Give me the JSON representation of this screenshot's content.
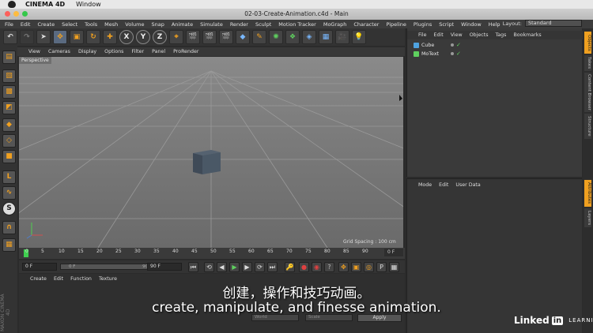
{
  "mac": {
    "app_name": "CINEMA 4D",
    "menu_window": "Window"
  },
  "window": {
    "title": "02-03-Create-Animation.c4d - Main"
  },
  "menu": [
    "File",
    "Edit",
    "Create",
    "Select",
    "Tools",
    "Mesh",
    "Volume",
    "Snap",
    "Animate",
    "Simulate",
    "Render",
    "Sculpt",
    "Motion Tracker",
    "MoGraph",
    "Character",
    "Pipeline",
    "Plugins",
    "Script",
    "Window",
    "Help"
  ],
  "layout": {
    "label": "Layout:",
    "value": "Standard"
  },
  "toolbar": {
    "x_label": "X",
    "y_label": "Y",
    "z_label": "Z"
  },
  "viewport": {
    "menu": [
      "View",
      "Cameras",
      "Display",
      "Options",
      "Filter",
      "Panel",
      "ProRender"
    ],
    "camera_label": "Perspective",
    "grid_spacing": "Grid Spacing : 100 cm"
  },
  "timeline": {
    "ticks": [
      "0",
      "5",
      "10",
      "15",
      "20",
      "25",
      "30",
      "35",
      "40",
      "45",
      "50",
      "55",
      "60",
      "65",
      "70",
      "75",
      "80",
      "85",
      "90"
    ],
    "end_field": "0 F"
  },
  "transport": {
    "start_field": "0 F",
    "slider_left": "0 F",
    "slider_right": "90 F",
    "end_field": "90 F"
  },
  "material": {
    "menu": [
      "Create",
      "Edit",
      "Function",
      "Texture"
    ]
  },
  "objects": {
    "menu": [
      "File",
      "Edit",
      "View",
      "Objects",
      "Tags",
      "Bookmarks"
    ],
    "items": [
      {
        "name": "Cube",
        "icon_color": "#4fa3e0"
      },
      {
        "name": "MoText",
        "icon_color": "#5fd05f"
      }
    ]
  },
  "attributes": {
    "menu": [
      "Mode",
      "Edit",
      "User Data"
    ]
  },
  "right_tabs": [
    "Objects",
    "Takes",
    "Content Browser",
    "Structure",
    "Attributes",
    "Layers"
  ],
  "bottom": {
    "field_a": "World",
    "field_b": "Scale",
    "apply_label": "Apply"
  },
  "maxon_label": "MAXON CINEMA 4D",
  "subtitles": {
    "zh": "创建，操作和技巧动画。",
    "en": "create, manipulate, and finesse animation."
  },
  "branding": {
    "linkedin": "Linked",
    "in": "in",
    "learning": "LEARNING"
  },
  "colors": {
    "accent_orange": "#f0a020",
    "timeline_green": "#3fcf4f",
    "viewport_bg": "#7d7d7d"
  }
}
